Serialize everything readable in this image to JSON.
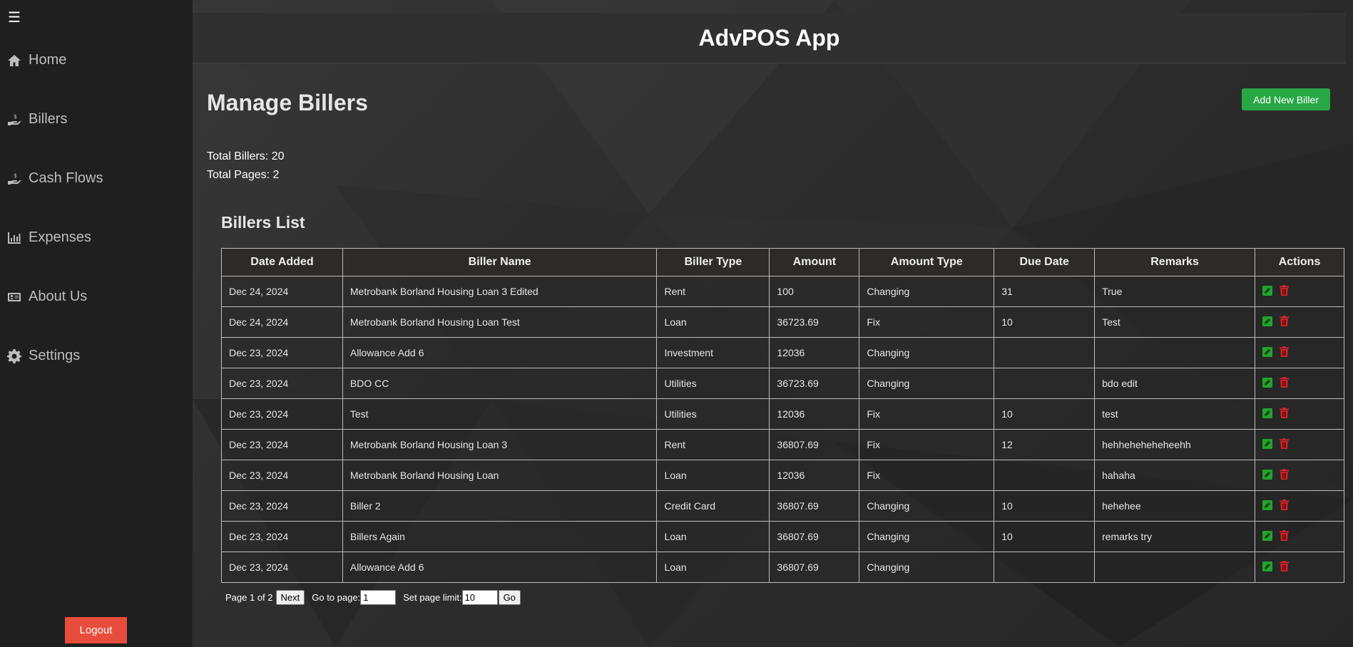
{
  "app_title": "AdvPOS App",
  "sidebar": {
    "menu_icon": "☰",
    "items": [
      {
        "label": "Home",
        "icon": "home-icon"
      },
      {
        "label": "Billers",
        "icon": "hand-dollar-icon"
      },
      {
        "label": "Cash Flows",
        "icon": "hand-dollar-icon"
      },
      {
        "label": "Expenses",
        "icon": "bar-chart-icon"
      },
      {
        "label": "About Us",
        "icon": "id-card-icon"
      },
      {
        "label": "Settings",
        "icon": "gear-icon"
      }
    ],
    "logout_label": "Logout"
  },
  "main": {
    "title": "Manage Billers",
    "add_button": "Add New Biller",
    "total_billers": "Total Billers: 20",
    "total_pages": "Total Pages: 2",
    "list_title": "Billers List",
    "columns": [
      "Date Added",
      "Biller Name",
      "Biller Type",
      "Amount",
      "Amount Type",
      "Due Date",
      "Remarks",
      "Actions"
    ],
    "rows": [
      [
        "Dec 24, 2024",
        "Metrobank Borland Housing Loan 3 Edited",
        "Rent",
        "100",
        "Changing",
        "31",
        "True"
      ],
      [
        "Dec 24, 2024",
        "Metrobank Borland Housing Loan Test",
        "Loan",
        "36723.69",
        "Fix",
        "10",
        "Test"
      ],
      [
        "Dec 23, 2024",
        "Allowance Add 6",
        "Investment",
        "12036",
        "Changing",
        "",
        ""
      ],
      [
        "Dec 23, 2024",
        "BDO CC",
        "Utilities",
        "36723.69",
        "Changing",
        "",
        "bdo edit"
      ],
      [
        "Dec 23, 2024",
        "Test",
        "Utilities",
        "12036",
        "Fix",
        "10",
        "test"
      ],
      [
        "Dec 23, 2024",
        "Metrobank Borland Housing Loan 3",
        "Rent",
        "36807.69",
        "Fix",
        "12",
        "hehheheheheheehh"
      ],
      [
        "Dec 23, 2024",
        "Metrobank Borland Housing Loan",
        "Loan",
        "12036",
        "Fix",
        "",
        "hahaha"
      ],
      [
        "Dec 23, 2024",
        "Biller 2",
        "Credit Card",
        "36807.69",
        "Changing",
        "10",
        "hehehee"
      ],
      [
        "Dec 23, 2024",
        "Billers Again",
        "Loan",
        "36807.69",
        "Changing",
        "10",
        "remarks try"
      ],
      [
        "Dec 23, 2024",
        "Allowance Add 6",
        "Loan",
        "36807.69",
        "Changing",
        "",
        ""
      ]
    ],
    "pager": {
      "page_info": "Page 1 of 2",
      "next_label": "Next",
      "goto_label": "Go to page:",
      "goto_value": "1",
      "limit_label": "Set page limit:",
      "limit_value": "10",
      "go_label": "Go"
    }
  },
  "colors": {
    "accent_green": "#28a745",
    "logout_red": "#e74c3c",
    "edit_icon": "#22a32a",
    "delete_icon": "#d9242a"
  }
}
